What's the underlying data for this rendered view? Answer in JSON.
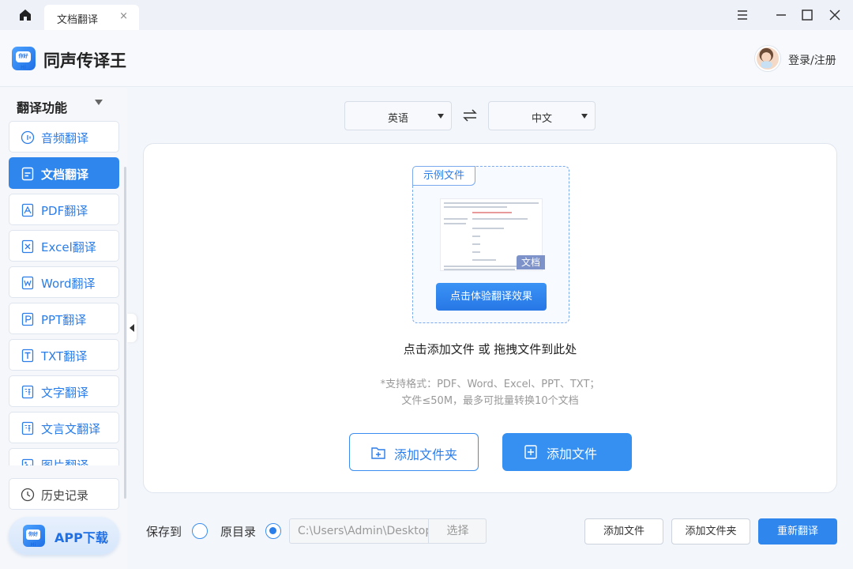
{
  "tab": {
    "title": "文档翻译",
    "close": "×"
  },
  "header": {
    "app_title": "同声传译王",
    "login": "登录/注册",
    "logo_text": "你好 Hi"
  },
  "sidebar": {
    "heading": "翻译功能",
    "items": [
      {
        "label": "音频翻译",
        "icon": "audio-icon"
      },
      {
        "label": "文档翻译",
        "icon": "document-icon",
        "active": true
      },
      {
        "label": "PDF翻译",
        "icon": "pdf-icon"
      },
      {
        "label": "Excel翻译",
        "icon": "excel-icon"
      },
      {
        "label": "Word翻译",
        "icon": "word-icon"
      },
      {
        "label": "PPT翻译",
        "icon": "ppt-icon"
      },
      {
        "label": "TXT翻译",
        "icon": "txt-icon"
      },
      {
        "label": "文字翻译",
        "icon": "translate-icon"
      },
      {
        "label": "文言文翻译",
        "icon": "translate-icon"
      },
      {
        "label": "图片翻译",
        "icon": "image-icon"
      }
    ],
    "history": "历史记录",
    "app_download": "APP下载"
  },
  "lang": {
    "source": "英语",
    "target": "中文"
  },
  "card": {
    "sample_tag": "示例文件",
    "doc_badge": "文档",
    "try_button": "点击体验翻译效果",
    "drop_text": "点击添加文件 或 拖拽文件到此处",
    "hint_line1": "*支持格式：PDF、Word、Excel、PPT、TXT；",
    "hint_line2": "文件≤50M，最多可批量转换10个文档",
    "add_folder": "添加文件夹",
    "add_file": "添加文件"
  },
  "bottom": {
    "save_to": "保存到",
    "original_dir": "原目录",
    "path_value": "C:\\Users\\Admin\\Desktop",
    "choose": "选择",
    "add_file": "添加文件",
    "add_folder": "添加文件夹",
    "retranslate": "重新翻译"
  },
  "colors": {
    "accent": "#2f87ee",
    "sidebar_text": "#2b7de9"
  }
}
